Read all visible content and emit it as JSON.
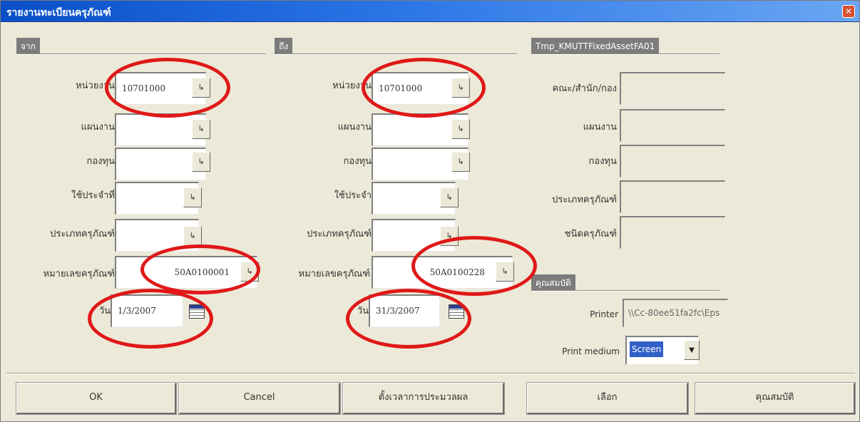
{
  "window": {
    "title": "รายงานทะเบียนครุภัณฑ์",
    "close_glyph": "✕"
  },
  "from_section": {
    "tab": "จาก",
    "labels": {
      "unit": "หน่วยงาน",
      "plan": "แผนงาน",
      "fund": "กองทุน",
      "user": "ใช้ประจำที่",
      "asset_type": "ประเภทครุภัณฑ์",
      "asset_no": "หมายเลขครุภัณฑ์",
      "date": "วัน"
    },
    "values": {
      "unit": "10701000",
      "plan": "",
      "fund": "",
      "user": "",
      "asset_type": "",
      "asset_no": "50A0100001",
      "date": "1/3/2007"
    }
  },
  "to_section": {
    "tab": "ถึง",
    "labels": {
      "unit": "หน่วยงาน",
      "plan": "แผนงาน",
      "fund": "กองทุน",
      "user": "ใช้ประจำ",
      "asset_type": "ประเภทครุภัณฑ์",
      "asset_no": "หมายเลขครุภัณฑ์",
      "date": "วัน"
    },
    "values": {
      "unit": "10701000",
      "plan": "",
      "fund": "",
      "user": "",
      "asset_type": "",
      "asset_no": "50A0100228",
      "date": "31/3/2007"
    }
  },
  "tmp_section": {
    "tab": "Tmp_KMUTTFixedAssetFA01",
    "labels": {
      "faculty": "คณะ/สำนัก/กอง",
      "plan": "แผนงาน",
      "fund": "กองทุน",
      "asset_type": "ประเภทครุภัณฑ์",
      "asset_kind": "ชนิดครุภัณฑ์"
    }
  },
  "properties_section": {
    "tab": "คุณสมบัติ",
    "printer_label": "Printer",
    "printer_value": "\\\\Cc-80ee51fa2fc\\Eps",
    "medium_label": "Print medium",
    "medium_value": "Screen"
  },
  "buttons": {
    "ok": "OK",
    "cancel": "Cancel",
    "schedule": "ตั้งเวลาการประมวลผล",
    "select": "เลือก",
    "properties": "คุณสมบัติ"
  },
  "icons": {
    "lookup": "lookup-arrow-icon",
    "calendar": "calendar-icon",
    "dropdown": "dropdown-arrow-icon"
  },
  "colors": {
    "titlebar": "#0a4fc8",
    "annotation_oval": "#e01818",
    "selection": "#3160c8"
  }
}
